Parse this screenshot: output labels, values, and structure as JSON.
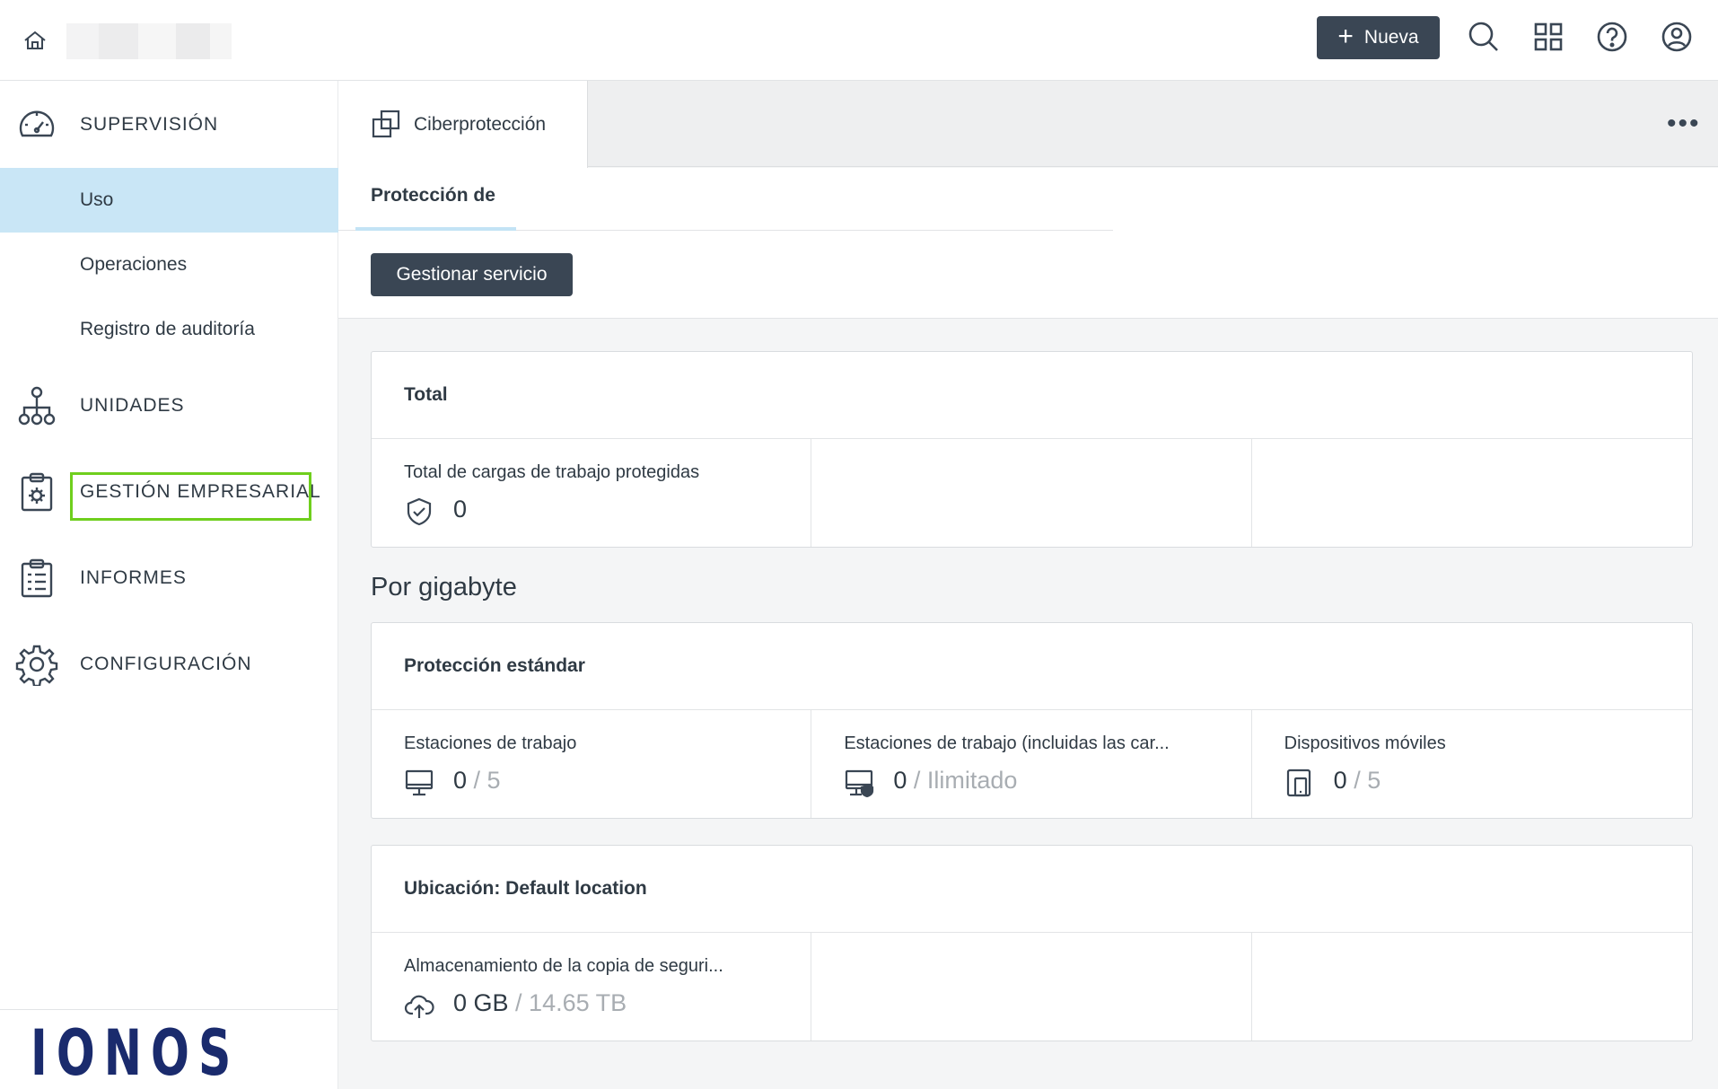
{
  "topbar": {
    "new_label": "Nueva",
    "icons": [
      "home-icon",
      "search-icon",
      "apps-grid-icon",
      "help-icon",
      "user-account-icon"
    ]
  },
  "sidebar": {
    "groups": [
      {
        "label": "SUPERVISIÓN",
        "icon": "speedometer-icon"
      },
      {
        "label": "UNIDADES",
        "icon": "hierarchy-icon"
      },
      {
        "label": "GESTIÓN EMPRESARIAL",
        "icon": "clipboard-gear-icon"
      },
      {
        "label": "INFORMES",
        "icon": "report-icon"
      },
      {
        "label": "CONFIGURACIÓN",
        "icon": "gear-icon"
      }
    ],
    "sub_items": [
      {
        "label": "Uso",
        "active": true
      },
      {
        "label": "Operaciones",
        "active": false
      },
      {
        "label": "Registro de auditoría",
        "active": false
      }
    ],
    "logo_text": "IONOS"
  },
  "tabs": {
    "active_label": "Ciberprotección",
    "subtab_label": "Protección de",
    "manage_button": "Gestionar servicio"
  },
  "cards": {
    "total": {
      "title": "Total",
      "cells": [
        {
          "label": "Total de cargas de trabajo protegidas",
          "value": "0",
          "limit": ""
        }
      ]
    },
    "per_gb_title": "Por gigabyte",
    "standard": {
      "title": "Protección estándar",
      "cells": [
        {
          "label": "Estaciones de trabajo",
          "value": "0",
          "limit": "/ 5"
        },
        {
          "label": "Estaciones de trabajo (incluidas las car...",
          "value": "0",
          "limit": "/ Ilimitado"
        },
        {
          "label": "Dispositivos móviles",
          "value": "0",
          "limit": "/ 5"
        }
      ]
    },
    "location": {
      "title": "Ubicación: Default location",
      "cells": [
        {
          "label": "Almacenamiento de la copia de seguri...",
          "value": "0 GB",
          "limit": "/ 14.65 TB"
        }
      ]
    }
  },
  "colors": {
    "dark_button": "#3a4654",
    "active_nav": "#c9e6f6",
    "highlight_border": "#6fcf1d",
    "logo": "#1a2b6d"
  }
}
